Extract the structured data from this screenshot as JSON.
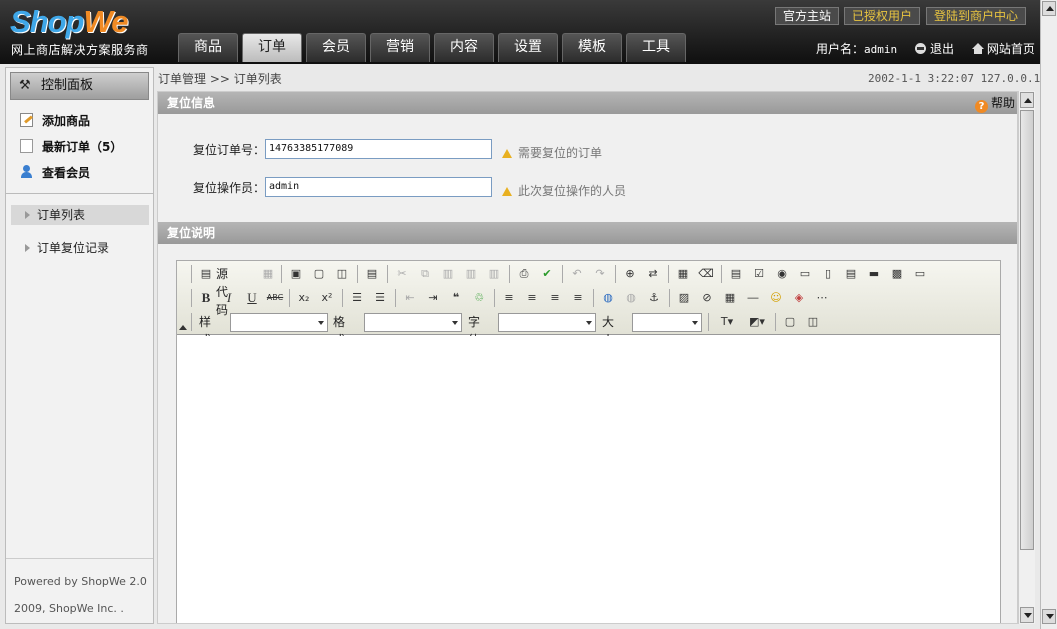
{
  "header": {
    "logo_shop": "Shop",
    "logo_we": "We",
    "slogan": "网上商店解决方案服务商",
    "top_links": [
      "官方主站",
      "已授权用户",
      "登陆到商户中心"
    ],
    "nav_tabs": [
      "商品",
      "订单",
      "会员",
      "营销",
      "内容",
      "设置",
      "模板",
      "工具"
    ],
    "active_tab": "订单",
    "username_label": "用户名：",
    "username": "admin",
    "logout_label": "退出",
    "home_label": "网站首页"
  },
  "sidebar": {
    "panel_title": "控制面板",
    "quick_links": [
      "添加商品",
      "最新订单（5）",
      "查看会员"
    ],
    "sub_items": [
      "订单列表",
      "订单复位记录"
    ],
    "active_sub": "订单列表",
    "powered": "Powered by ShopWe 2.0",
    "copyright": "2009, ShopWe Inc. ."
  },
  "breadcrumb": "订单管理 >> 订单列表",
  "datetime": "2002-1-1 3:22:07 127.0.0.1",
  "reset_info": {
    "title": "复位信息",
    "help": "帮助",
    "order_no_label": "复位订单号：",
    "order_no_value": "14763385177089",
    "order_no_hint": "需要复位的订单",
    "operator_label": "复位操作员：",
    "operator_value": "admin",
    "operator_hint": "此次复位操作的人员"
  },
  "reset_desc": {
    "title": "复位说明"
  },
  "editor": {
    "source_label": "源代码",
    "style_label": "样式",
    "format_label": "格式",
    "font_label": "字体",
    "size_label": "大小",
    "bold": "B",
    "italic": "I",
    "underline": "U",
    "strike": "ABC"
  }
}
